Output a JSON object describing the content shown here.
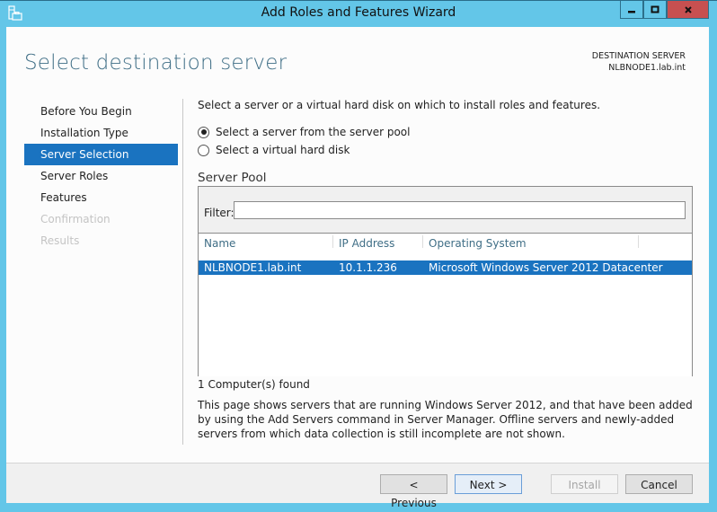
{
  "window": {
    "title": "Add Roles and Features Wizard",
    "icon": "server-manager-icon",
    "controls": {
      "minimize": "minimize-icon",
      "maximize": "maximize-icon",
      "close": "close-icon"
    }
  },
  "header": {
    "page_title": "Select destination server",
    "destination_label": "DESTINATION SERVER",
    "destination_value": "NLBNODE1.lab.int"
  },
  "nav": {
    "items": [
      {
        "label": "Before You Begin",
        "state": "normal"
      },
      {
        "label": "Installation Type",
        "state": "normal"
      },
      {
        "label": "Server Selection",
        "state": "active"
      },
      {
        "label": "Server Roles",
        "state": "normal"
      },
      {
        "label": "Features",
        "state": "normal"
      },
      {
        "label": "Confirmation",
        "state": "disabled"
      },
      {
        "label": "Results",
        "state": "disabled"
      }
    ]
  },
  "content": {
    "intro": "Select a server or a virtual hard disk on which to install roles and features.",
    "options": [
      {
        "label": "Select a server from the server pool",
        "checked": true
      },
      {
        "label": "Select a virtual hard disk",
        "checked": false
      }
    ],
    "pool_label": "Server Pool",
    "filter_label": "Filter:",
    "filter_value": "",
    "columns": [
      "Name",
      "IP Address",
      "Operating System"
    ],
    "rows": [
      {
        "name": "NLBNODE1.lab.int",
        "ip": "10.1.1.236",
        "os": "Microsoft Windows Server 2012 Datacenter",
        "selected": true
      }
    ],
    "found": "1 Computer(s) found",
    "description": "This page shows servers that are running Windows Server 2012, and that have been added by using the Add Servers command in Server Manager. Offline servers and newly-added servers from which data collection is still incomplete are not shown."
  },
  "footer": {
    "previous": "< Previous",
    "next": "Next >",
    "install": "Install",
    "cancel": "Cancel"
  },
  "colors": {
    "titlebar": "#63c6e8",
    "accent": "#1a73c0",
    "close": "#c75050",
    "heading": "#3f6e86"
  }
}
